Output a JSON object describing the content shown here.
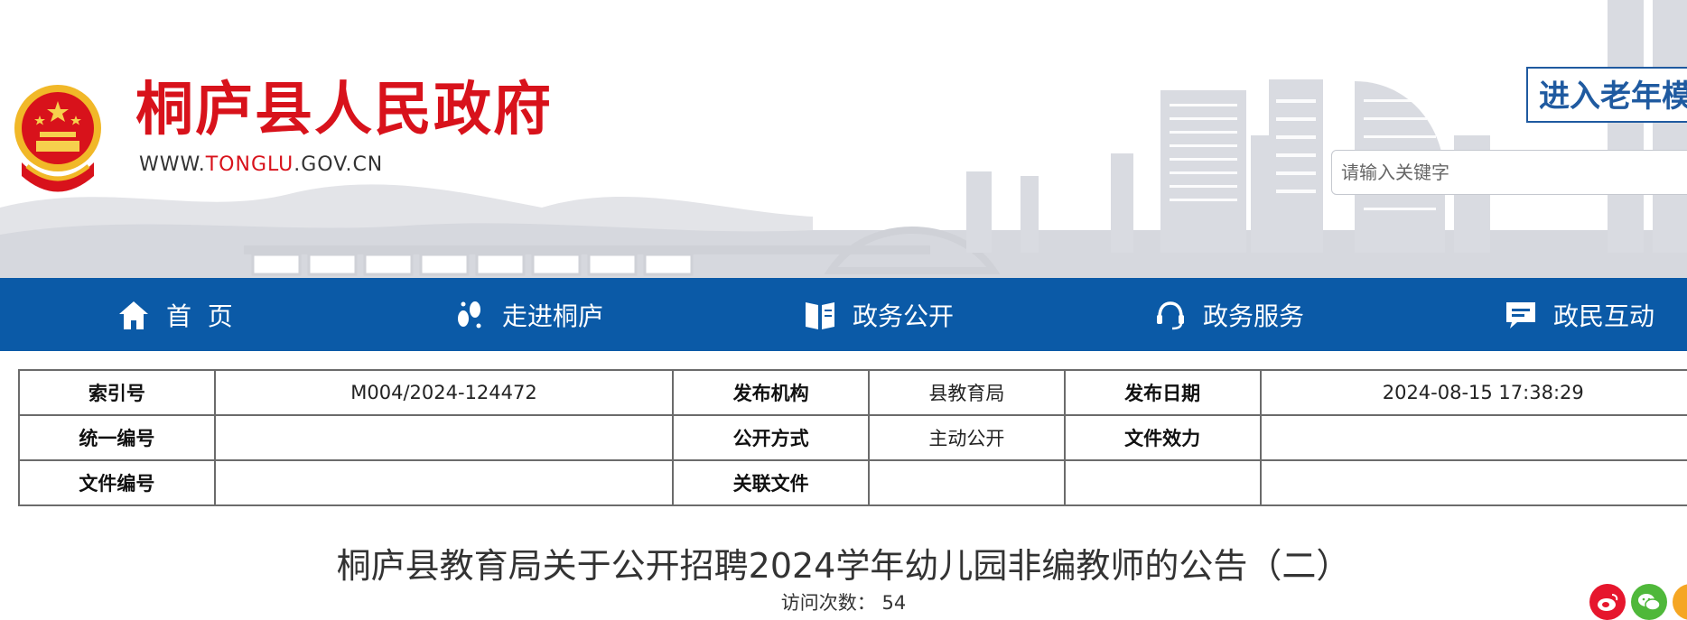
{
  "site": {
    "title": "桐庐县人民政府",
    "url_prefix": "WWW.",
    "url_highlight": "TONGLU",
    "url_suffix": ".GOV.CN",
    "title_color": "#d8121b"
  },
  "header": {
    "elder_mode_label": "进入老年模式",
    "search_placeholder": "请输入关键字"
  },
  "nav": {
    "color": "#0b5aa7",
    "items": [
      {
        "label": "首  页",
        "icon": "home-icon"
      },
      {
        "label": "走进桐庐",
        "icon": "footprints-icon"
      },
      {
        "label": "政务公开",
        "icon": "open-book-icon"
      },
      {
        "label": "政务服务",
        "icon": "headset-icon"
      },
      {
        "label": "政民互动",
        "icon": "chat-icon"
      }
    ]
  },
  "meta_table": {
    "rows": [
      {
        "l1": "索引号",
        "v1": "M004/2024-124472",
        "l2": "发布机构",
        "v2": "县教育局",
        "l3": "发布日期",
        "v3": "2024-08-15 17:38:29"
      },
      {
        "l1": "统一编号",
        "v1": "",
        "l2": "公开方式",
        "v2": "主动公开",
        "l3": "文件效力",
        "v3": ""
      },
      {
        "l1": "文件编号",
        "v1": "",
        "l2": "关联文件",
        "v2": "",
        "l3": "",
        "v3": ""
      }
    ]
  },
  "article": {
    "title": "桐庐县教育局关于公开招聘2024学年幼儿园非编教师的公告（二）",
    "visits_label": "访问次数：",
    "visits_count": "54"
  },
  "share": {
    "icons": [
      "weibo-icon",
      "wechat-icon",
      "more-share-icon"
    ],
    "colors": {
      "weibo": "#e6162d",
      "wechat": "#4fb83a",
      "other": "#f5a623"
    }
  }
}
